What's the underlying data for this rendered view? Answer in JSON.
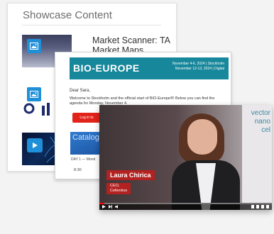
{
  "showcase": {
    "title": "Showcase Content",
    "items": [
      {
        "title": "Market Scanner: TA Market Maps",
        "icon": "image-icon"
      },
      {
        "icon": "image-icon"
      },
      {
        "icon": "play-icon"
      }
    ]
  },
  "email": {
    "brand": "BIO-EUROPE",
    "dates_line1": "November 4-6, 2024 | Stockholm",
    "dates_line2": "November 12-13, 2024 | Digital",
    "greeting": "Dear Sara,",
    "body": "Welcome to Stockholm and the official start of BIO-Europe®! Below you can find the agenda for Monday, November 4.",
    "login_label": "Log in to",
    "catalog_label": "Catalog",
    "day_text": "DAY 1 — Mond",
    "time_text": "8:30"
  },
  "video": {
    "speaker_name": "Laura Chirica",
    "speaker_role_line1": "CEO,",
    "speaker_role_line2": "Cellenkos",
    "poster_text_line1": "vector",
    "poster_text_line2": "nano",
    "poster_text_line3": "cel",
    "progress_fraction": 0.03
  },
  "colors": {
    "accent_blue": "#1f8fd8",
    "bio_teal": "#17879b",
    "cta_red": "#e2231a",
    "lower_third_red": "#b32121"
  }
}
